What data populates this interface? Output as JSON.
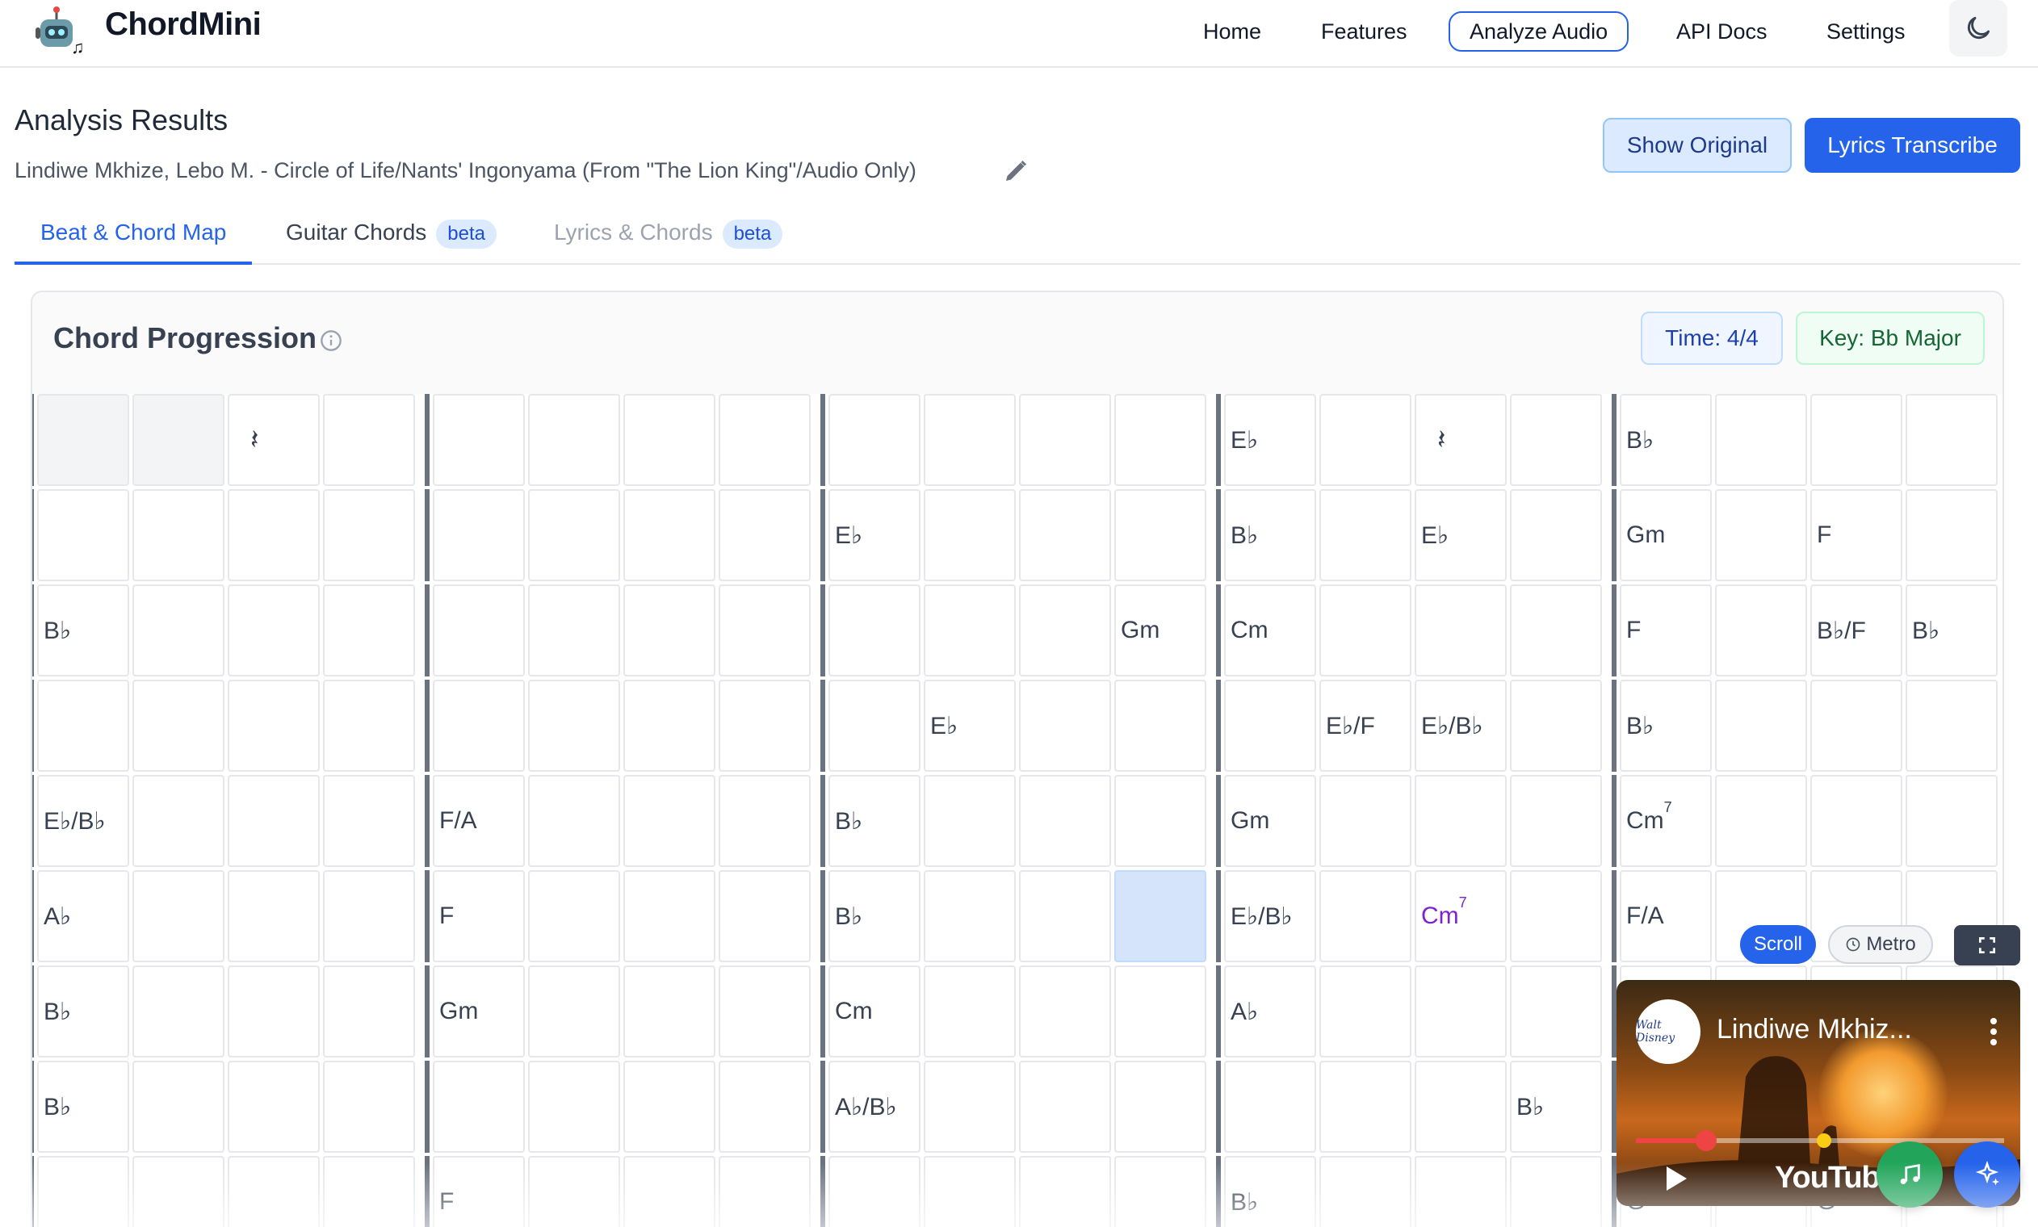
{
  "nav": {
    "brand": "ChordMini",
    "links": [
      "Home",
      "Features",
      "Analyze Audio",
      "API Docs",
      "Settings"
    ],
    "active_link": "Analyze Audio",
    "theme_icon": "moon-icon"
  },
  "header": {
    "title": "Analysis Results",
    "song_title": "Lindiwe Mkhize, Lebo M. - Circle of Life/Nants' Ingonyama (From \"The Lion King\"/Audio Only)",
    "show_original_label": "Show Original",
    "lyrics_transcribe_label": "Lyrics Transcribe"
  },
  "tabs": [
    {
      "label": "Beat & Chord Map",
      "badge": "",
      "state": "active"
    },
    {
      "label": "Guitar Chords",
      "badge": "beta",
      "state": "normal"
    },
    {
      "label": "Lyrics & Chords",
      "badge": "beta",
      "state": "muted"
    }
  ],
  "chord_panel": {
    "title": "Chord Progression",
    "time_signature": "Time: 4/4",
    "key": "Key: Bb Major",
    "rows": [
      [
        "",
        "",
        "𝄽",
        "",
        "",
        "",
        "",
        "",
        "",
        "",
        "",
        "",
        "E♭",
        "",
        "𝄽",
        "",
        "B♭",
        "",
        "",
        ""
      ],
      [
        "",
        "",
        "",
        "",
        "",
        "",
        "",
        "",
        "E♭",
        "",
        "",
        "",
        "B♭",
        "",
        "E♭",
        "",
        "Gm",
        "",
        "F",
        ""
      ],
      [
        "B♭",
        "",
        "",
        "",
        "",
        "",
        "",
        "",
        "",
        "",
        "",
        "Gm",
        "Cm",
        "",
        "",
        "",
        "F",
        "",
        "B♭/F",
        "B♭"
      ],
      [
        "",
        "",
        "",
        "",
        "",
        "",
        "",
        "",
        "",
        "E♭",
        "",
        "",
        "",
        "E♭/F",
        "E♭/B♭",
        "",
        "B♭",
        "",
        "",
        ""
      ],
      [
        "E♭/B♭",
        "",
        "",
        "",
        "F/A",
        "",
        "",
        "",
        "B♭",
        "",
        "",
        "",
        "Gm",
        "",
        "",
        "",
        "Cm7",
        "",
        "",
        ""
      ],
      [
        "A♭",
        "",
        "",
        "",
        "F",
        "",
        "",
        "",
        "B♭",
        "",
        "",
        "",
        "E♭/B♭",
        "",
        "Cm7",
        "",
        "F/A",
        "",
        "",
        ""
      ],
      [
        "B♭",
        "",
        "",
        "",
        "Gm",
        "",
        "",
        "",
        "Cm",
        "",
        "",
        "",
        "A♭",
        "",
        "",
        "",
        "",
        "",
        "",
        ""
      ],
      [
        "B♭",
        "",
        "",
        "",
        "",
        "",
        "",
        "",
        "A♭/B♭",
        "",
        "",
        "",
        "",
        "",
        "",
        "B♭",
        "",
        "",
        "",
        ""
      ],
      [
        "",
        "",
        "",
        "",
        "F",
        "",
        "",
        "",
        "",
        "",
        "",
        "",
        "B♭",
        "",
        "",
        "",
        "G",
        "",
        "G",
        ""
      ]
    ],
    "shaded_cells": [
      "0-0",
      "0-1"
    ],
    "current_cell": "5-11",
    "purple_cells": [
      "5-14"
    ]
  },
  "player": {
    "scroll_label": "Scroll",
    "metro_label": "Metro",
    "channel_label": "Walt Disney",
    "video_title": "Lindiwe Mkhiz...",
    "yt_label": "YouTube",
    "progress": 0.19,
    "marker": 0.51
  },
  "colors": {
    "accent": "#2563eb",
    "current_beat": "#d6e4fb",
    "chord_highlight": "#7e22ce",
    "key_pill": "#166534",
    "music_fab": "#22a55b"
  }
}
